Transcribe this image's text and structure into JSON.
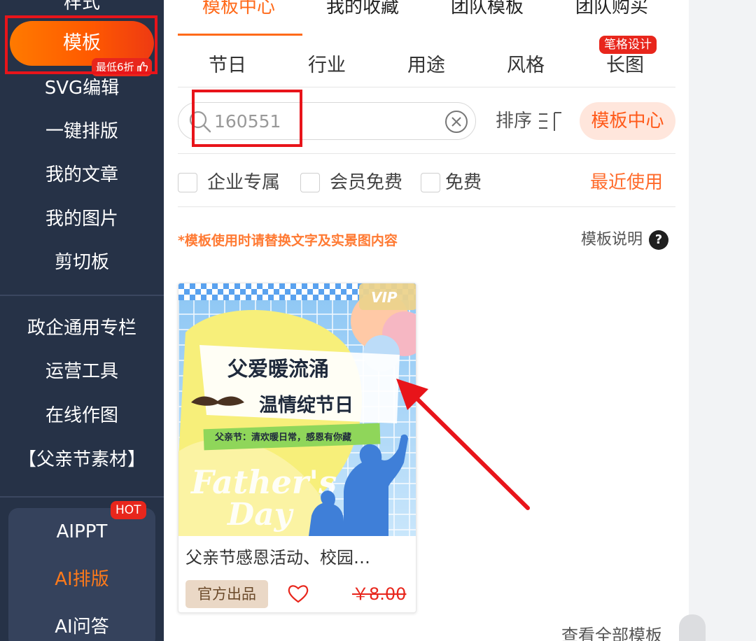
{
  "sidebar": {
    "items": [
      {
        "label": "样式"
      },
      {
        "label": "模板",
        "active": true,
        "badge": "最低6折"
      },
      {
        "label": "SVG编辑"
      },
      {
        "label": "一键排版"
      },
      {
        "label": "我的文章"
      },
      {
        "label": "我的图片"
      },
      {
        "label": "剪切板"
      }
    ],
    "section2": [
      "政企通用专栏",
      "运营工具",
      "在线作图",
      "【父亲节素材】"
    ],
    "ai": {
      "hot_badge": "HOT",
      "items": [
        "AIPPT",
        "AI排版",
        "AI问答"
      ],
      "highlight_color": "#ff7a1a"
    },
    "accent_color": "#ff6a00",
    "background_color": "#263247"
  },
  "tabs": {
    "top": [
      "模板中心",
      "我的收藏",
      "团队模板",
      "团队购买"
    ],
    "active": "模板中心",
    "categories": [
      "节日",
      "行业",
      "用途",
      "风格",
      "长图"
    ],
    "category_badge": "笔格设计"
  },
  "search": {
    "value": "160551",
    "sort_label": "排序",
    "center_button": "模板中心"
  },
  "filters": {
    "checkboxes": [
      {
        "label": "企业专属",
        "checked": false
      },
      {
        "label": "会员免费",
        "checked": false
      },
      {
        "label": "免费",
        "checked": false
      }
    ],
    "recent": "最近使用"
  },
  "notice": "*模板使用时请替换文字及实景图内容",
  "explain": "模板说明",
  "help_icon": "?",
  "template_card": {
    "vip_badge": "VIP",
    "poster_title_line1": "父爱暖流涌",
    "poster_title_line2": "温情绽节日",
    "poster_subtitle": "父亲节：清欢暖日常，感恩有你藏",
    "poster_script_line1": "Father's",
    "poster_script_line2": "Day",
    "title": "父亲节感恩活动、校园…",
    "tag": "官方出品",
    "price": "￥8.00"
  },
  "view_all": "查看全部模板",
  "annotation_color": "#e8141a"
}
